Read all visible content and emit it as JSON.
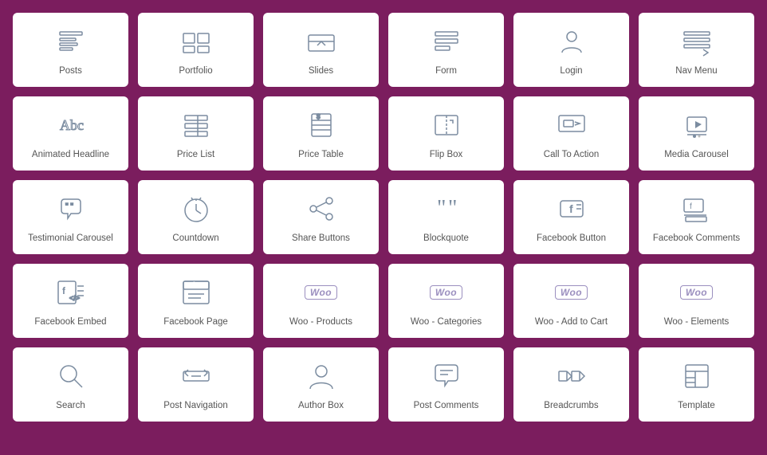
{
  "cards": [
    {
      "id": "posts",
      "label": "Posts",
      "icon": "posts"
    },
    {
      "id": "portfolio",
      "label": "Portfolio",
      "icon": "portfolio"
    },
    {
      "id": "slides",
      "label": "Slides",
      "icon": "slides"
    },
    {
      "id": "form",
      "label": "Form",
      "icon": "form"
    },
    {
      "id": "login",
      "label": "Login",
      "icon": "login"
    },
    {
      "id": "nav-menu",
      "label": "Nav Menu",
      "icon": "nav-menu"
    },
    {
      "id": "animated-headline",
      "label": "Animated Headline",
      "icon": "animated-headline"
    },
    {
      "id": "price-list",
      "label": "Price List",
      "icon": "price-list"
    },
    {
      "id": "price-table",
      "label": "Price Table",
      "icon": "price-table"
    },
    {
      "id": "flip-box",
      "label": "Flip Box",
      "icon": "flip-box"
    },
    {
      "id": "call-to-action",
      "label": "Call To Action",
      "icon": "call-to-action"
    },
    {
      "id": "media-carousel",
      "label": "Media Carousel",
      "icon": "media-carousel"
    },
    {
      "id": "testimonial-carousel",
      "label": "Testimonial Carousel",
      "icon": "testimonial-carousel"
    },
    {
      "id": "countdown",
      "label": "Countdown",
      "icon": "countdown"
    },
    {
      "id": "share-buttons",
      "label": "Share Buttons",
      "icon": "share-buttons"
    },
    {
      "id": "blockquote",
      "label": "Blockquote",
      "icon": "blockquote"
    },
    {
      "id": "facebook-button",
      "label": "Facebook Button",
      "icon": "facebook-button"
    },
    {
      "id": "facebook-comments",
      "label": "Facebook Comments",
      "icon": "facebook-comments"
    },
    {
      "id": "facebook-embed",
      "label": "Facebook Embed",
      "icon": "facebook-embed"
    },
    {
      "id": "facebook-page",
      "label": "Facebook Page",
      "icon": "facebook-page"
    },
    {
      "id": "woo-products",
      "label": "Woo - Products",
      "icon": "woo"
    },
    {
      "id": "woo-categories",
      "label": "Woo - Categories",
      "icon": "woo"
    },
    {
      "id": "woo-add-to-cart",
      "label": "Woo - Add to Cart",
      "icon": "woo"
    },
    {
      "id": "woo-elements",
      "label": "Woo - Elements",
      "icon": "woo"
    },
    {
      "id": "search",
      "label": "Search",
      "icon": "search"
    },
    {
      "id": "post-navigation",
      "label": "Post Navigation",
      "icon": "post-navigation"
    },
    {
      "id": "author-box",
      "label": "Author Box",
      "icon": "author-box"
    },
    {
      "id": "post-comments",
      "label": "Post Comments",
      "icon": "post-comments"
    },
    {
      "id": "breadcrumbs",
      "label": "Breadcrumbs",
      "icon": "breadcrumbs"
    },
    {
      "id": "template",
      "label": "Template",
      "icon": "template"
    }
  ]
}
